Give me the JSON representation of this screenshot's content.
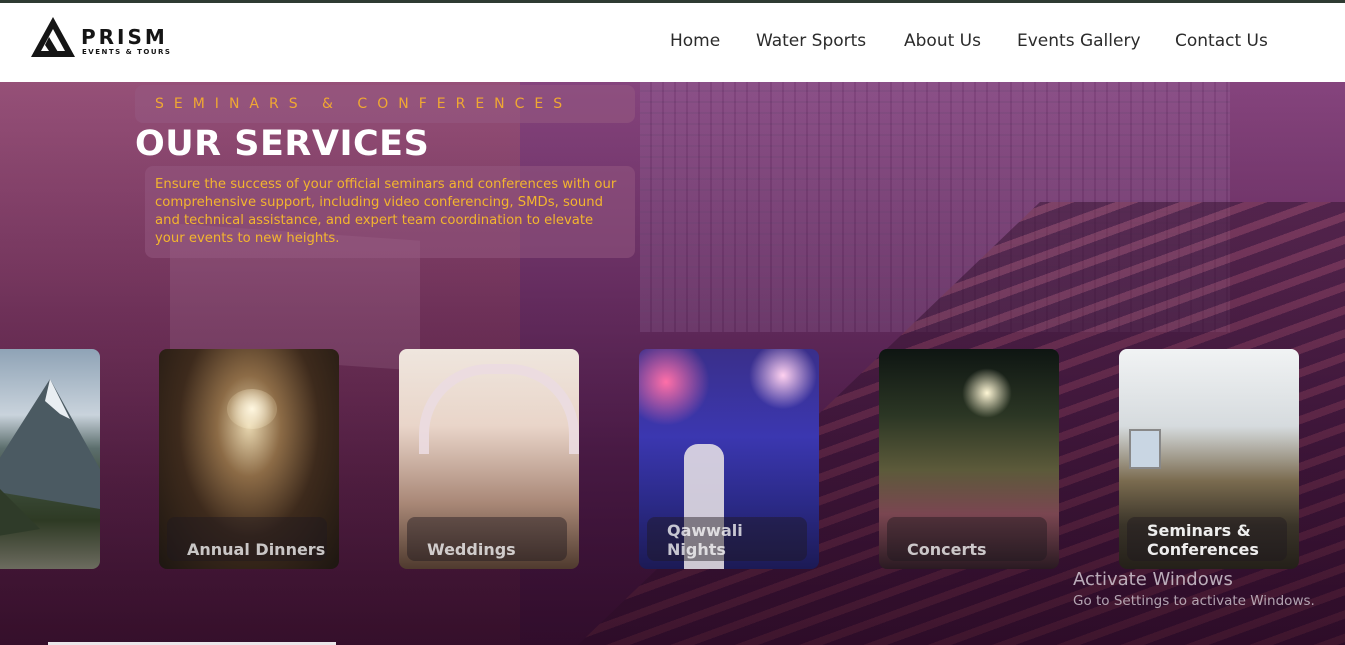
{
  "brand": {
    "name": "PRISM",
    "tagline": "EVENTS & TOURS"
  },
  "nav": {
    "items": [
      {
        "label": "Home"
      },
      {
        "label": "Water Sports"
      },
      {
        "label": "About Us"
      },
      {
        "label": "Events Gallery"
      },
      {
        "label": "Contact Us"
      }
    ]
  },
  "hero": {
    "kicker": "SEMINARS & CONFERENCES",
    "title": "OUR SERVICES",
    "description": "Ensure the success of your official seminars and conferences with our comprehensive support, including video conferencing, SMDs, sound and technical assistance, and expert team coordination to elevate your events to new heights."
  },
  "cards": [
    {
      "label": ""
    },
    {
      "label": "Annual Dinners"
    },
    {
      "label": "Weddings"
    },
    {
      "label": "Qawwali Nights"
    },
    {
      "label": "Concerts"
    },
    {
      "label": "Seminars & Conferences"
    }
  ],
  "watermark": {
    "title": "Activate Windows",
    "subtitle": "Go to Settings to activate Windows."
  },
  "colors": {
    "accent": "#f0a832",
    "navText": "#2b2b2b",
    "heroTint": "#6e3568"
  }
}
